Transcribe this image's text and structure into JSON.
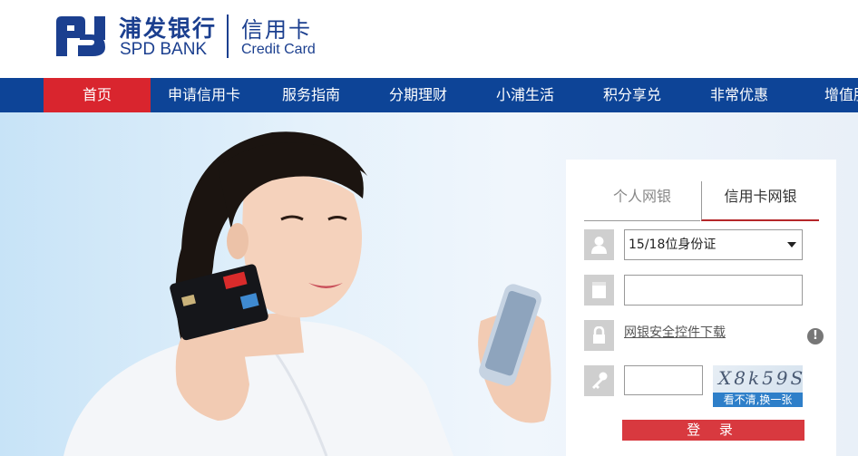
{
  "brand": {
    "name_cn": "浦发银行",
    "name_en": "SPD BANK",
    "product_cn": "信用卡",
    "product_en": "Credit Card"
  },
  "nav": {
    "items": [
      {
        "label": "首页",
        "active": true
      },
      {
        "label": "申请信用卡",
        "active": false
      },
      {
        "label": "服务指南",
        "active": false
      },
      {
        "label": "分期理财",
        "active": false
      },
      {
        "label": "小浦生活",
        "active": false
      },
      {
        "label": "积分享兑",
        "active": false
      },
      {
        "label": "非常优惠",
        "active": false
      },
      {
        "label": "增值服",
        "active": false
      }
    ],
    "colors": {
      "bar": "#0d4497",
      "active": "#d9252e"
    }
  },
  "login": {
    "tabs": [
      {
        "label": "个人网银",
        "active": false
      },
      {
        "label": "信用卡网银",
        "active": true
      }
    ],
    "id_type": {
      "selected": "15/18位身份证"
    },
    "id_input": {
      "value": ""
    },
    "security_download_label": "网银安全控件下载",
    "info_icon": "!",
    "captcha": {
      "image_text": "X8k59S",
      "refresh_label": "看不清,换一张",
      "value": ""
    },
    "submit_label": "登 录",
    "icons": [
      "user-icon",
      "card-icon",
      "lock-icon",
      "key-icon"
    ]
  }
}
